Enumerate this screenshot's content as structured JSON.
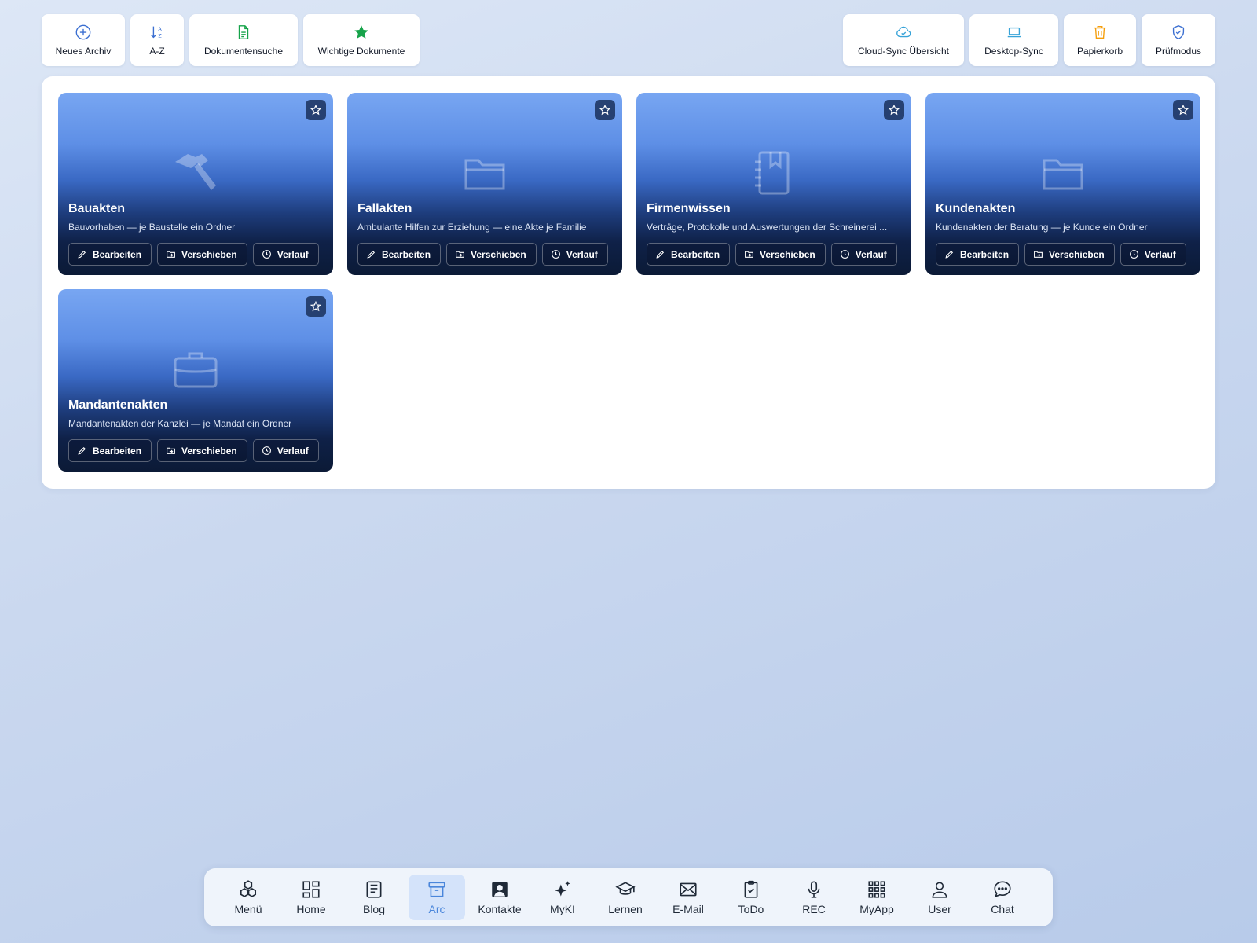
{
  "toolbar": {
    "left": [
      {
        "label": "Neues Archiv",
        "icon": "plus-circle-icon"
      },
      {
        "label": "A-Z",
        "icon": "sort-az-icon"
      },
      {
        "label": "Dokumentensuche",
        "icon": "document-icon"
      },
      {
        "label": "Wichtige Dokumente",
        "icon": "star-filled-icon"
      }
    ],
    "right": [
      {
        "label": "Cloud-Sync Übersicht",
        "icon": "cloud-check-icon"
      },
      {
        "label": "Desktop-Sync",
        "icon": "laptop-icon"
      },
      {
        "label": "Papierkorb",
        "icon": "trash-icon"
      },
      {
        "label": "Prüfmodus",
        "icon": "shield-check-icon"
      }
    ]
  },
  "archives": [
    {
      "title": "Bauakten",
      "description": "Bauvorhaben — je Baustelle ein Ordner",
      "icon": "hammer-icon"
    },
    {
      "title": "Fallakten",
      "description": "Ambulante Hilfen zur Erziehung — eine Akte je Familie",
      "icon": "folder-icon"
    },
    {
      "title": "Firmenwissen",
      "description": "Verträge, Protokolle und Auswertungen der Schreinerei ...",
      "icon": "notebook-icon"
    },
    {
      "title": "Kundenakten",
      "description": "Kundenakten der Beratung — je Kunde ein Ordner",
      "icon": "folder-icon"
    },
    {
      "title": "Mandantenakten",
      "description": "Mandantenakten der Kanzlei — je Mandat ein Ordner",
      "icon": "briefcase-icon"
    }
  ],
  "card_actions": {
    "edit": "Bearbeiten",
    "move": "Verschieben",
    "history": "Verlauf"
  },
  "dock": {
    "active": "Arc",
    "items": [
      {
        "label": "Menü",
        "icon": "cubes-icon"
      },
      {
        "label": "Home",
        "icon": "dashboard-icon"
      },
      {
        "label": "Blog",
        "icon": "blog-icon"
      },
      {
        "label": "Arc",
        "icon": "archive-box-icon"
      },
      {
        "label": "Kontakte",
        "icon": "contact-icon"
      },
      {
        "label": "MyKI",
        "icon": "sparkles-icon"
      },
      {
        "label": "Lernen",
        "icon": "graduation-cap-icon"
      },
      {
        "label": "E-Mail",
        "icon": "envelope-icon"
      },
      {
        "label": "ToDo",
        "icon": "clipboard-check-icon"
      },
      {
        "label": "REC",
        "icon": "microphone-icon"
      },
      {
        "label": "MyApp",
        "icon": "app-grid-icon"
      },
      {
        "label": "User",
        "icon": "user-icon"
      },
      {
        "label": "Chat",
        "icon": "chat-bubble-icon"
      }
    ]
  },
  "colors": {
    "accent_blue": "#4a86db",
    "favorite_green": "#16a34a",
    "trash_orange": "#f59e0b",
    "sync_blue": "#38a3d8"
  }
}
